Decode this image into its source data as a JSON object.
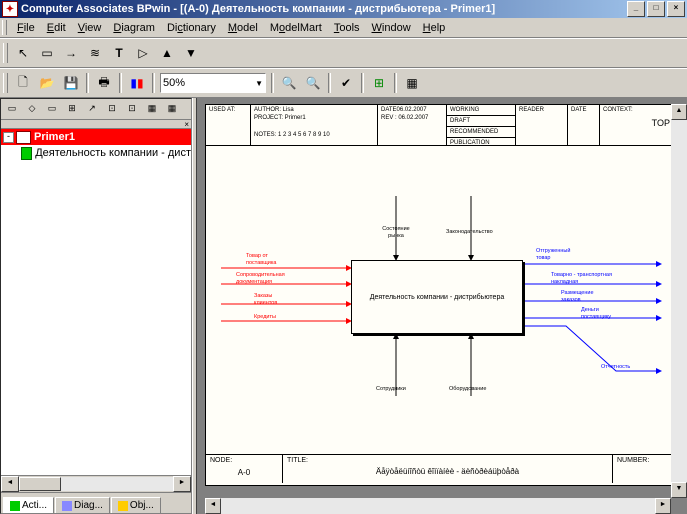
{
  "title": "Computer Associates BPwin - [(A-0) Деятельность компании - дистрибьютера - Primer1]",
  "menu": {
    "file": "File",
    "edit": "Edit",
    "view": "View",
    "diagram": "Diagram",
    "dictionary": "Dictionary",
    "model": "Model",
    "modelmart": "ModelMart",
    "tools": "Tools",
    "window": "Window",
    "help": "Help"
  },
  "zoom": "50%",
  "tree": {
    "root": "Primer1",
    "child": "Деятельность компании - дист"
  },
  "tabs": {
    "acti": "Acti...",
    "diag": "Diag...",
    "obj": "Obj..."
  },
  "header": {
    "used_at": "USED AT:",
    "author": "AUTHOR: Lisa",
    "project": "PROJECT: Primer1",
    "notes": "NOTES: 1 2 3 4 5 6 7 8 9 10",
    "date": "DATE06.02.2007",
    "rev": "REV : 06.02.2007",
    "working": "WORKING",
    "draft": "DRAFT",
    "recommended": "RECOMMENDED",
    "publication": "PUBLICATION",
    "reader": "READER",
    "datecol": "DATE",
    "context": "CONTEXT:",
    "top": "TOP"
  },
  "box": "Деятельность компании - дистрибьютера",
  "arrows": {
    "in1": "Товар от\nпоставщика",
    "in2": "Сопроводительная\nдокументация",
    "in3": "Заказы\nклиентов",
    "in4": "Кредиты",
    "top1": "Состояние\nрынка",
    "top2": "Законодательство",
    "out1": "Отгруженный\nтовар",
    "out2": "Товарно - транспортная\nнакладная",
    "out3": "Размещение\nзаказов",
    "out4": "Деньги\nпоставщику",
    "out5": "Отчетность",
    "bot1": "Сотрудники",
    "bot2": "Оборудование"
  },
  "footer": {
    "node": "NODE:",
    "nodeval": "A-0",
    "titlelbl": "TITLE:",
    "titleval": "Äåÿòåëüíîñòü êîìïàíèè - äèñòðèáüþòåðà",
    "number": "NUMBER:"
  }
}
